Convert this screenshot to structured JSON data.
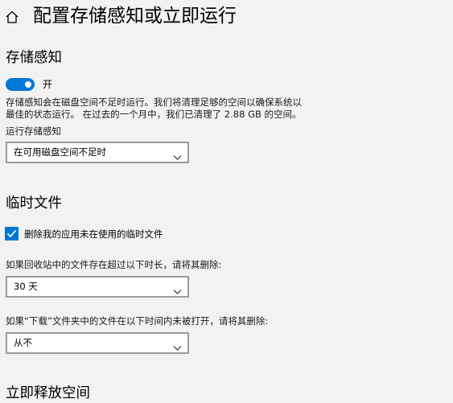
{
  "header": {
    "title": "配置存储感知或立即运行"
  },
  "storage_sense": {
    "section_title": "存储感知",
    "toggle_state": "on",
    "toggle_label": "开",
    "description_line1": "存储感知会在磁盘空间不足时运行。我们将清理足够的空间以确保系统以",
    "description_line2": "最佳的状态运行。 在过去的一个月中，我们已清理了 2.88 GB 的空间。",
    "run_label": "运行存储感知",
    "run_selected": "在可用磁盘空间不足时"
  },
  "temp_files": {
    "section_title": "临时文件",
    "delete_checkbox_checked": true,
    "delete_checkbox_label": "删除我的应用未在使用的临时文件",
    "recycle_label": "如果回收站中的文件存在超过以下时长，请将其删除:",
    "recycle_selected": "30 天",
    "downloads_label": "如果“下载”文件夹中的文件在以下时间内未被打开，请将其删除:",
    "downloads_selected": "从不"
  },
  "free_space": {
    "section_title": "立即释放空间"
  },
  "colors": {
    "accent": "#0078d7",
    "background": "#f2f2f2",
    "dropdown_border": "#9a9a9a"
  },
  "icons": {
    "home": "home-icon",
    "chevron": "chevron-down-icon",
    "check": "checkmark-icon"
  }
}
